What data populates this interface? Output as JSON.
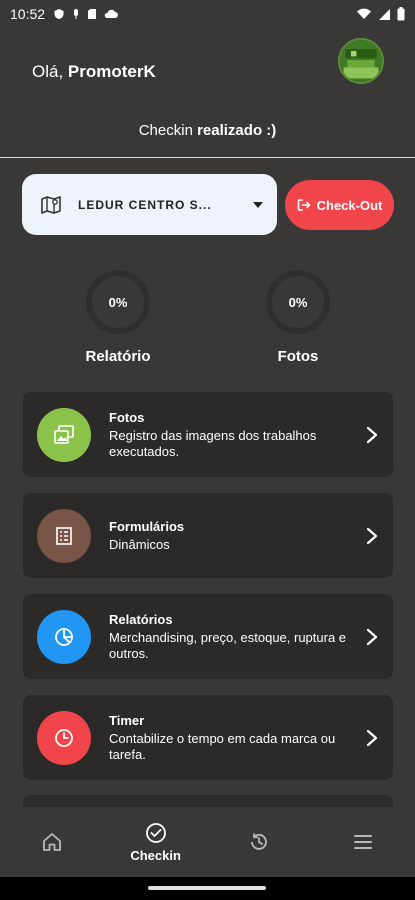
{
  "status_bar": {
    "time": "10:52"
  },
  "header": {
    "greeting_prefix": "Olá, ",
    "user_name": "PromoterK"
  },
  "checkin_status": {
    "prefix": "Checkin ",
    "status": "realizado :)"
  },
  "store": {
    "name": "LEDUR CENTRO S..."
  },
  "checkout_label": "Check-Out",
  "stats": [
    {
      "value": "0%",
      "label": "Relatório"
    },
    {
      "value": "0%",
      "label": "Fotos"
    }
  ],
  "cards": [
    {
      "title": "Fotos",
      "desc": "Registro das imagens dos trabalhos executados.",
      "color": "#8bc34a",
      "icon": "photos-icon"
    },
    {
      "title": "Formulários",
      "desc": "Dinâmicos",
      "color": "#795548",
      "icon": "form-icon"
    },
    {
      "title": "Relatórios",
      "desc": "Merchandising, preço, estoque, ruptura e outros.",
      "color": "#2196f3",
      "icon": "pie-chart-icon"
    },
    {
      "title": "Timer",
      "desc": "Contabilize o tempo em cada marca ou tarefa.",
      "color": "#f0454a",
      "icon": "clock-icon"
    }
  ],
  "bottom_nav": [
    {
      "label": "",
      "icon": "home-icon"
    },
    {
      "label": "Checkin",
      "icon": "check-circle-icon",
      "active": true
    },
    {
      "label": "",
      "icon": "history-icon"
    },
    {
      "label": "",
      "icon": "menu-icon"
    }
  ],
  "colors": {
    "background": "#3a3836",
    "card": "#2c2a28",
    "checkout": "#f0454a",
    "select_bg": "#eef3fa"
  }
}
